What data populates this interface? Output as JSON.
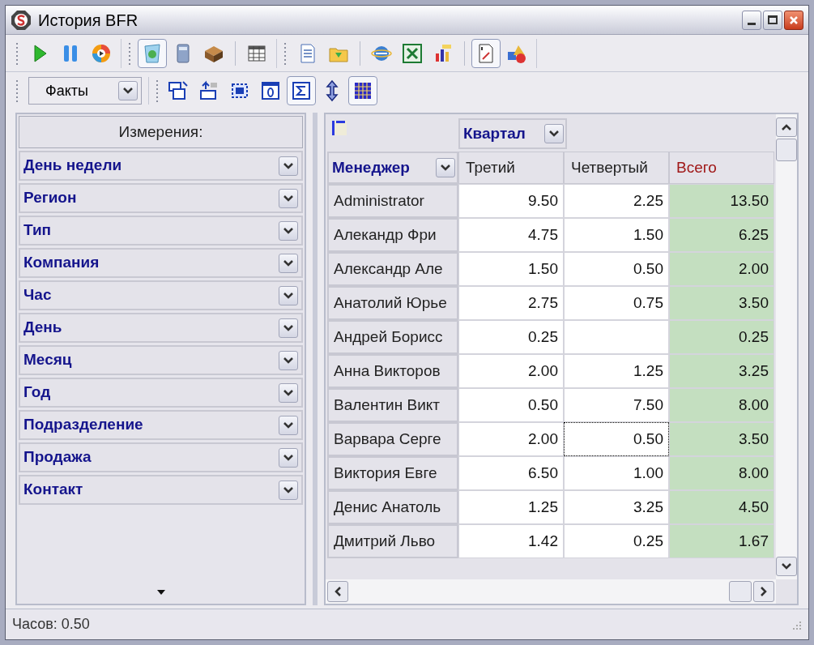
{
  "window": {
    "title": "История BFR"
  },
  "toolbar_1": [
    {
      "buttons": [
        {
          "kind": "play",
          "pressed": false
        },
        {
          "kind": "pause",
          "pressed": false
        },
        {
          "kind": "disc",
          "pressed": false
        }
      ]
    },
    {
      "buttons": [
        {
          "kind": "sheet",
          "pressed": true
        },
        {
          "kind": "calculator",
          "pressed": false
        },
        {
          "kind": "box",
          "pressed": false
        },
        {
          "kind": "separator"
        },
        {
          "kind": "table",
          "pressed": false
        }
      ]
    },
    {
      "buttons": [
        {
          "kind": "document",
          "pressed": false
        },
        {
          "kind": "folder",
          "pressed": false
        },
        {
          "kind": "separator"
        },
        {
          "kind": "globe",
          "pressed": false
        },
        {
          "kind": "excel",
          "pressed": false
        },
        {
          "kind": "chart",
          "pressed": false
        },
        {
          "kind": "separator"
        },
        {
          "kind": "report",
          "pressed": true
        },
        {
          "kind": "shapes",
          "pressed": false
        }
      ]
    }
  ],
  "toolbar_2": {
    "combo": {
      "value": "Факты"
    },
    "buttons": [
      {
        "kind": "windows",
        "pressed": false
      },
      {
        "kind": "align",
        "pressed": false
      },
      {
        "kind": "frame",
        "pressed": false
      },
      {
        "kind": "zero",
        "pressed": false
      },
      {
        "kind": "sigma",
        "pressed": true
      },
      {
        "kind": "updown",
        "pressed": false
      },
      {
        "kind": "grid",
        "pressed": true
      }
    ]
  },
  "dimensions": {
    "title": "Измерения:",
    "items": [
      "День недели",
      "Регион",
      "Тип",
      "Компания",
      "Час",
      "День",
      "Месяц",
      "Год",
      "Подразделение",
      "Продажа",
      "Контакт"
    ]
  },
  "grid": {
    "column_field": "Квартал",
    "row_field": "Менеджер",
    "columns": [
      {
        "label": "Третий",
        "kind": "data"
      },
      {
        "label": "Четвертый",
        "kind": "data"
      },
      {
        "label": "Всего",
        "kind": "total"
      }
    ],
    "rows": [
      {
        "label": "Administrator",
        "cells": [
          {
            "value": "9.50",
            "selected": false
          },
          {
            "value": "2.25",
            "selected": false
          },
          {
            "value": "13.50",
            "selected": false
          }
        ]
      },
      {
        "label": "Алекандр Фри",
        "cells": [
          {
            "value": "4.75",
            "selected": false
          },
          {
            "value": "1.50",
            "selected": false
          },
          {
            "value": "6.25",
            "selected": false
          }
        ]
      },
      {
        "label": "Александр Але",
        "cells": [
          {
            "value": "1.50",
            "selected": false
          },
          {
            "value": "0.50",
            "selected": false
          },
          {
            "value": "2.00",
            "selected": false
          }
        ]
      },
      {
        "label": "Анатолий Юрье",
        "cells": [
          {
            "value": "2.75",
            "selected": false
          },
          {
            "value": "0.75",
            "selected": false
          },
          {
            "value": "3.50",
            "selected": false
          }
        ]
      },
      {
        "label": "Андрей Борисс",
        "cells": [
          {
            "value": "0.25",
            "selected": false
          },
          {
            "selected": false
          },
          {
            "value": "0.25",
            "selected": false
          }
        ]
      },
      {
        "label": "Анна Викторов",
        "cells": [
          {
            "value": "2.00",
            "selected": false
          },
          {
            "value": "1.25",
            "selected": false
          },
          {
            "value": "3.25",
            "selected": false
          }
        ]
      },
      {
        "label": "Валентин Викт",
        "cells": [
          {
            "value": "0.50",
            "selected": false
          },
          {
            "value": "7.50",
            "selected": false
          },
          {
            "value": "8.00",
            "selected": false
          }
        ]
      },
      {
        "label": "Варвара Серге",
        "cells": [
          {
            "value": "2.00",
            "selected": false
          },
          {
            "value": "0.50",
            "selected": true
          },
          {
            "value": "3.50",
            "selected": false
          }
        ]
      },
      {
        "label": "Виктория Евге",
        "cells": [
          {
            "value": "6.50",
            "selected": false
          },
          {
            "value": "1.00",
            "selected": false
          },
          {
            "value": "8.00",
            "selected": false
          }
        ]
      },
      {
        "label": "Денис Анатоль",
        "cells": [
          {
            "value": "1.25",
            "selected": false
          },
          {
            "value": "3.25",
            "selected": false
          },
          {
            "value": "4.50",
            "selected": false
          }
        ]
      },
      {
        "label": "Дмитрий Льво",
        "cells": [
          {
            "value": "1.42",
            "selected": false
          },
          {
            "value": "0.25",
            "selected": false
          },
          {
            "value": "1.67",
            "selected": false
          }
        ]
      }
    ]
  },
  "status_bar": {
    "text": "Часов: 0.50"
  }
}
